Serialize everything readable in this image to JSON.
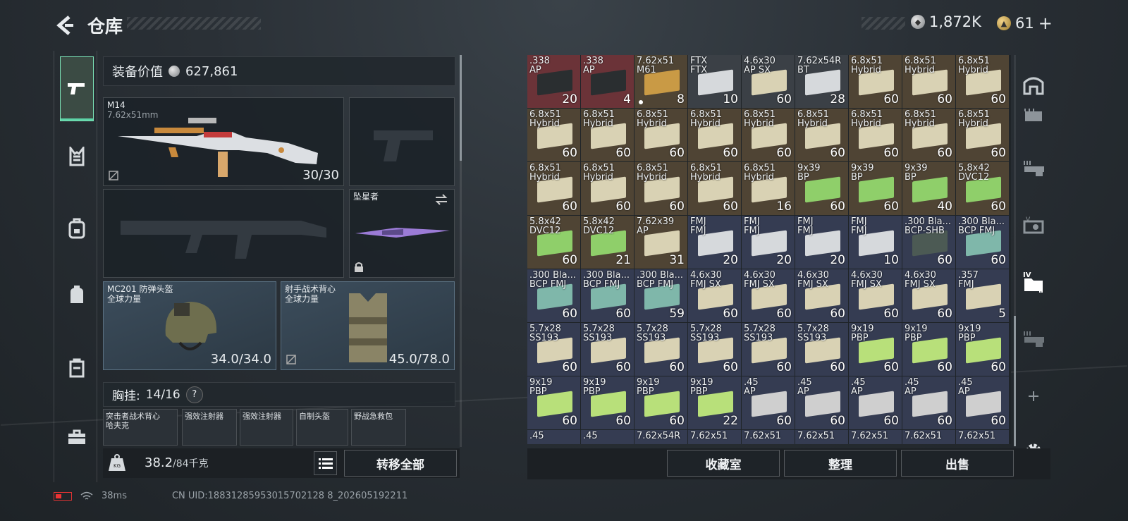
{
  "header": {
    "title": "仓库",
    "silver": "1,872K",
    "gold": "61",
    "gold_plus": "+"
  },
  "equip": {
    "label": "装备价值",
    "value": "627,861"
  },
  "slots": {
    "primary": {
      "name": "M14",
      "caliber": "7.62x51mm",
      "ammo": "30/30"
    },
    "melee": {
      "name": "坠星者"
    },
    "helmet": {
      "name": "MC201 防弹头盔",
      "brand": "全球力量",
      "durability": "34.0/34.0"
    },
    "armor": {
      "name": "射手战术背心",
      "brand": "全球力量",
      "durability": "45.0/78.0"
    }
  },
  "chest": {
    "label": "胸挂:",
    "count": "14/16",
    "help": "?"
  },
  "chest_items": [
    "突击者战术背心\n哈夫克",
    "强效注射器",
    "强效注射器",
    "自制头盔",
    "野战急救包"
  ],
  "weight": {
    "value": "38.2",
    "max": "/84千克",
    "badge": "KG"
  },
  "buttons": {
    "transfer_all": "转移全部",
    "collection": "收藏室",
    "organize": "整理",
    "sell": "出售"
  },
  "status": {
    "ping": "38ms",
    "uid": "CN UID:18831285953015702128 8_202605192211"
  },
  "colors": {
    "accent": "#5dd4a7",
    "red_item": "#6b3338",
    "gold_item": "#4f4434",
    "blue_item": "#353c52"
  },
  "inventory": [
    {
      "l1": ".338",
      "l2": "AP",
      "count": "20",
      "bg": "red",
      "box": "#2a2e30"
    },
    {
      "l1": ".338",
      "l2": "AP",
      "count": "4",
      "bg": "red",
      "box": "#2a2e30"
    },
    {
      "l1": "7.62x51",
      "l2": "M61",
      "count": "8",
      "bg": "gold",
      "box": "#c99a45",
      "dot": true
    },
    {
      "l1": "FTX",
      "l2": "FTX",
      "count": "10",
      "bg": "",
      "box": "#d6d9dc"
    },
    {
      "l1": "4.6x30",
      "l2": "AP SX",
      "count": "60",
      "bg": "",
      "box": "#d9d2b4"
    },
    {
      "l1": "7.62x54R",
      "l2": "BT",
      "count": "28",
      "bg": "",
      "box": "#d6d9dc"
    },
    {
      "l1": "6.8x51",
      "l2": "Hybrid",
      "count": "60",
      "bg": "gold",
      "box": "#d9d2b4"
    },
    {
      "l1": "6.8x51",
      "l2": "Hybrid",
      "count": "60",
      "bg": "gold",
      "box": "#d9d2b4"
    },
    {
      "l1": "6.8x51",
      "l2": "Hybrid",
      "count": "60",
      "bg": "gold",
      "box": "#d9d2b4"
    },
    {
      "l1": "6.8x51",
      "l2": "Hybrid",
      "count": "60",
      "bg": "gold",
      "box": "#d9d2b4"
    },
    {
      "l1": "6.8x51",
      "l2": "Hybrid",
      "count": "60",
      "bg": "gold",
      "box": "#d9d2b4"
    },
    {
      "l1": "6.8x51",
      "l2": "Hybrid",
      "count": "60",
      "bg": "gold",
      "box": "#d9d2b4"
    },
    {
      "l1": "6.8x51",
      "l2": "Hybrid",
      "count": "60",
      "bg": "gold",
      "box": "#d9d2b4"
    },
    {
      "l1": "6.8x51",
      "l2": "Hybrid",
      "count": "60",
      "bg": "gold",
      "box": "#d9d2b4"
    },
    {
      "l1": "6.8x51",
      "l2": "Hybrid",
      "count": "60",
      "bg": "gold",
      "box": "#d9d2b4"
    },
    {
      "l1": "6.8x51",
      "l2": "Hybrid",
      "count": "60",
      "bg": "gold",
      "box": "#d9d2b4"
    },
    {
      "l1": "6.8x51",
      "l2": "Hybrid",
      "count": "60",
      "bg": "gold",
      "box": "#d9d2b4"
    },
    {
      "l1": "6.8x51",
      "l2": "Hybrid",
      "count": "60",
      "bg": "gold",
      "box": "#d9d2b4"
    },
    {
      "l1": "6.8x51",
      "l2": "Hybrid",
      "count": "60",
      "bg": "gold",
      "box": "#d9d2b4"
    },
    {
      "l1": "6.8x51",
      "l2": "Hybrid",
      "count": "60",
      "bg": "gold",
      "box": "#d9d2b4"
    },
    {
      "l1": "6.8x51",
      "l2": "Hybrid",
      "count": "60",
      "bg": "gold",
      "box": "#d9d2b4"
    },
    {
      "l1": "6.8x51",
      "l2": "Hybrid",
      "count": "60",
      "bg": "gold",
      "box": "#d9d2b4"
    },
    {
      "l1": "6.8x51",
      "l2": "Hybrid",
      "count": "16",
      "bg": "gold",
      "box": "#d9d2b4"
    },
    {
      "l1": "9x39",
      "l2": "BP",
      "count": "60",
      "bg": "gold",
      "box": "#8fcf6a"
    },
    {
      "l1": "9x39",
      "l2": "BP",
      "count": "60",
      "bg": "gold",
      "box": "#8fcf6a"
    },
    {
      "l1": "9x39",
      "l2": "BP",
      "count": "40",
      "bg": "gold",
      "box": "#8fcf6a"
    },
    {
      "l1": "5.8x42",
      "l2": "DVC12",
      "count": "60",
      "bg": "gold",
      "box": "#8fcf6a"
    },
    {
      "l1": "5.8x42",
      "l2": "DVC12",
      "count": "60",
      "bg": "gold",
      "box": "#8fcf6a"
    },
    {
      "l1": "5.8x42",
      "l2": "DVC12",
      "count": "21",
      "bg": "gold",
      "box": "#8fcf6a"
    },
    {
      "l1": "7.62x39",
      "l2": "AP",
      "count": "31",
      "bg": "gold",
      "box": "#d9d2b4"
    },
    {
      "l1": "FMJ",
      "l2": "FMJ",
      "count": "20",
      "bg": "blue",
      "box": "#d6d9dc"
    },
    {
      "l1": "FMJ",
      "l2": "FMJ",
      "count": "20",
      "bg": "blue",
      "box": "#d6d9dc"
    },
    {
      "l1": "FMJ",
      "l2": "FMJ",
      "count": "20",
      "bg": "blue",
      "box": "#d6d9dc"
    },
    {
      "l1": "FMJ",
      "l2": "FMJ",
      "count": "10",
      "bg": "blue",
      "box": "#d6d9dc"
    },
    {
      "l1": ".300 Bla...",
      "l2": "BCP-SHB",
      "count": "60",
      "bg": "blue",
      "box": "#4c5a54"
    },
    {
      "l1": ".300 Bla...",
      "l2": "BCP FMJ",
      "count": "60",
      "bg": "blue",
      "box": "#7fb7aa"
    },
    {
      "l1": ".300 Bla...",
      "l2": "BCP FMJ",
      "count": "60",
      "bg": "blue",
      "box": "#7fb7aa"
    },
    {
      "l1": ".300 Bla...",
      "l2": "BCP FMJ",
      "count": "60",
      "bg": "blue",
      "box": "#7fb7aa"
    },
    {
      "l1": ".300 Bla...",
      "l2": "BCP FMJ",
      "count": "59",
      "bg": "blue",
      "box": "#7fb7aa"
    },
    {
      "l1": "4.6x30",
      "l2": "FMJ SX",
      "count": "60",
      "bg": "blue",
      "box": "#d9d2b4"
    },
    {
      "l1": "4.6x30",
      "l2": "FMJ SX",
      "count": "60",
      "bg": "blue",
      "box": "#d9d2b4"
    },
    {
      "l1": "4.6x30",
      "l2": "FMJ SX",
      "count": "60",
      "bg": "blue",
      "box": "#d9d2b4"
    },
    {
      "l1": "4.6x30",
      "l2": "FMJ SX",
      "count": "60",
      "bg": "blue",
      "box": "#d9d2b4"
    },
    {
      "l1": "4.6x30",
      "l2": "FMJ SX",
      "count": "60",
      "bg": "blue",
      "box": "#d9d2b4"
    },
    {
      "l1": ".357",
      "l2": "FMJ",
      "count": "5",
      "bg": "blue",
      "box": "#d9d2b4"
    },
    {
      "l1": "5.7x28",
      "l2": "SS193",
      "count": "60",
      "bg": "blue",
      "box": "#d9d2b4"
    },
    {
      "l1": "5.7x28",
      "l2": "SS193",
      "count": "60",
      "bg": "blue",
      "box": "#d9d2b4"
    },
    {
      "l1": "5.7x28",
      "l2": "SS193",
      "count": "60",
      "bg": "blue",
      "box": "#d9d2b4"
    },
    {
      "l1": "5.7x28",
      "l2": "SS193",
      "count": "60",
      "bg": "blue",
      "box": "#d9d2b4"
    },
    {
      "l1": "5.7x28",
      "l2": "SS193",
      "count": "60",
      "bg": "blue",
      "box": "#d9d2b4"
    },
    {
      "l1": "5.7x28",
      "l2": "SS193",
      "count": "60",
      "bg": "blue",
      "box": "#d9d2b4"
    },
    {
      "l1": "9x19",
      "l2": "PBP",
      "count": "60",
      "bg": "blue",
      "box": "#b8e07a"
    },
    {
      "l1": "9x19",
      "l2": "PBP",
      "count": "60",
      "bg": "blue",
      "box": "#b8e07a"
    },
    {
      "l1": "9x19",
      "l2": "PBP",
      "count": "60",
      "bg": "blue",
      "box": "#b8e07a"
    },
    {
      "l1": "9x19",
      "l2": "PBP",
      "count": "60",
      "bg": "blue",
      "box": "#b8e07a"
    },
    {
      "l1": "9x19",
      "l2": "PBP",
      "count": "60",
      "bg": "blue",
      "box": "#b8e07a"
    },
    {
      "l1": "9x19",
      "l2": "PBP",
      "count": "60",
      "bg": "blue",
      "box": "#b8e07a"
    },
    {
      "l1": "9x19",
      "l2": "PBP",
      "count": "22",
      "bg": "blue",
      "box": "#b8e07a"
    },
    {
      "l1": ".45",
      "l2": "AP",
      "count": "60",
      "bg": "blue",
      "box": "#cfcfcf"
    },
    {
      "l1": ".45",
      "l2": "AP",
      "count": "60",
      "bg": "blue",
      "box": "#cfcfcf"
    },
    {
      "l1": ".45",
      "l2": "AP",
      "count": "60",
      "bg": "blue",
      "box": "#cfcfcf"
    },
    {
      "l1": ".45",
      "l2": "AP",
      "count": "60",
      "bg": "blue",
      "box": "#cfcfcf"
    },
    {
      "l1": ".45",
      "l2": "AP",
      "count": "60",
      "bg": "blue",
      "box": "#cfcfcf"
    },
    {
      "l1": ".45",
      "l2": "",
      "count": "",
      "bg": "blue",
      "box": "#cfcfcf"
    },
    {
      "l1": ".45",
      "l2": "",
      "count": "",
      "bg": "blue",
      "box": "#cfcfcf"
    },
    {
      "l1": "7.62x54R",
      "l2": "",
      "count": "",
      "bg": "blue",
      "box": "#d9d2b4"
    },
    {
      "l1": "7.62x51",
      "l2": "",
      "count": "",
      "bg": "blue",
      "box": "#d9d2b4"
    },
    {
      "l1": "7.62x51",
      "l2": "",
      "count": "",
      "bg": "blue",
      "box": "#d9d2b4"
    },
    {
      "l1": "7.62x51",
      "l2": "",
      "count": "",
      "bg": "blue",
      "box": "#d9d2b4"
    },
    {
      "l1": "7.62x51",
      "l2": "",
      "count": "",
      "bg": "blue",
      "box": "#d9d2b4"
    },
    {
      "l1": "7.62x51",
      "l2": "",
      "count": "",
      "bg": "blue",
      "box": "#d9d2b4"
    },
    {
      "l1": "7.62x51",
      "l2": "",
      "count": "",
      "bg": "blue",
      "box": "#d9d2b4"
    }
  ]
}
